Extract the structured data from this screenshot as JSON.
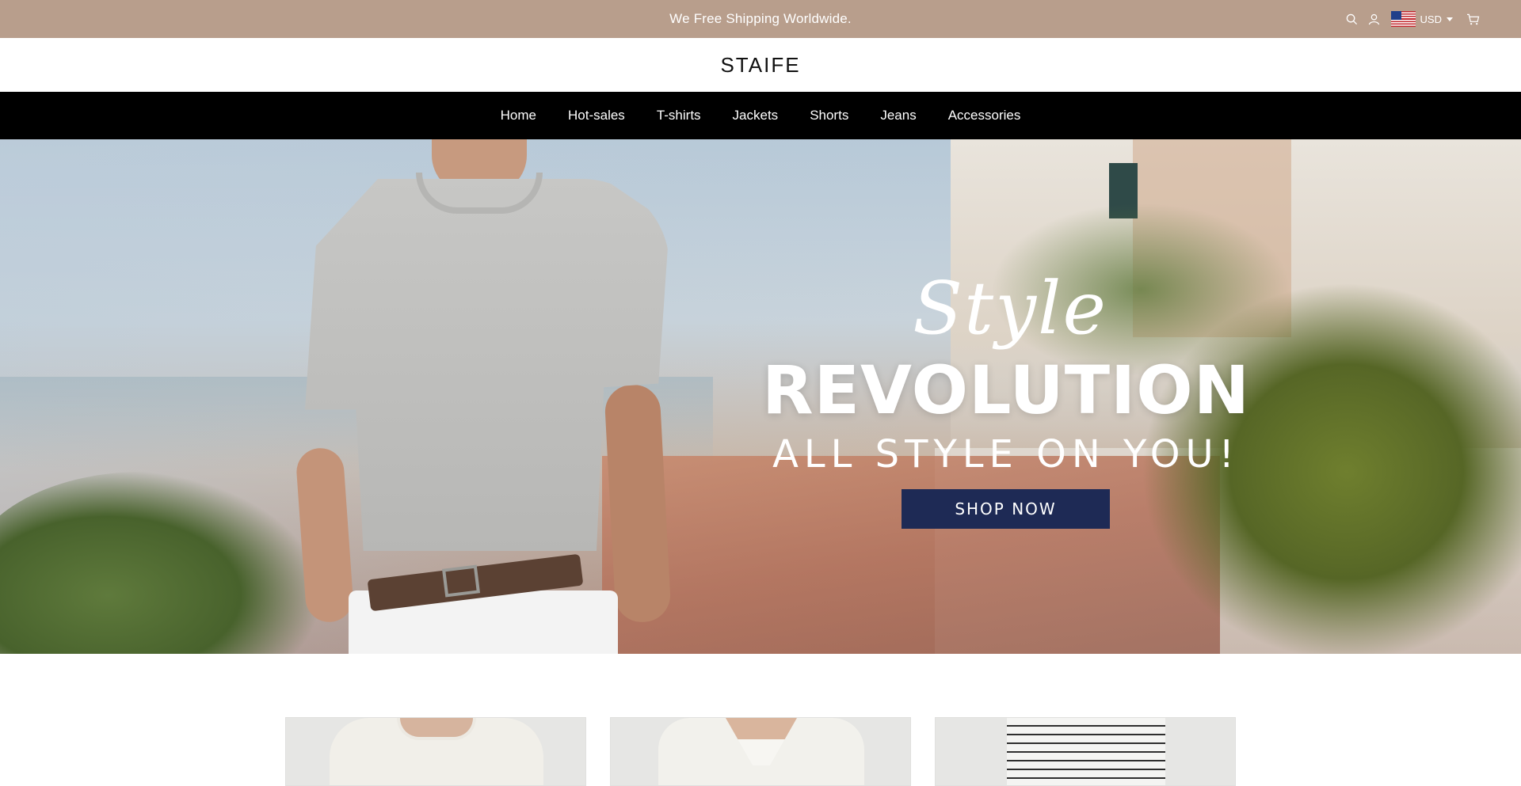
{
  "announcement": {
    "text": "We Free Shipping Worldwide."
  },
  "utility": {
    "currency": "USD",
    "icons": [
      "search-icon",
      "account-icon",
      "us-flag-icon",
      "cart-icon"
    ]
  },
  "brand": {
    "logo": "STAIFE"
  },
  "nav": {
    "items": [
      {
        "label": "Home"
      },
      {
        "label": "Hot-sales"
      },
      {
        "label": "T-shirts"
      },
      {
        "label": "Jackets"
      },
      {
        "label": "Shorts"
      },
      {
        "label": "Jeans"
      },
      {
        "label": "Accessories"
      }
    ]
  },
  "hero": {
    "script": "Style",
    "title": "REVOLUTION",
    "subtitle": "ALL STYLE ON YOU!",
    "cta": "SHOP NOW"
  },
  "colors": {
    "announcement_bg": "#b89e8c",
    "nav_bg": "#000000",
    "cta_bg": "#1e2a55"
  }
}
